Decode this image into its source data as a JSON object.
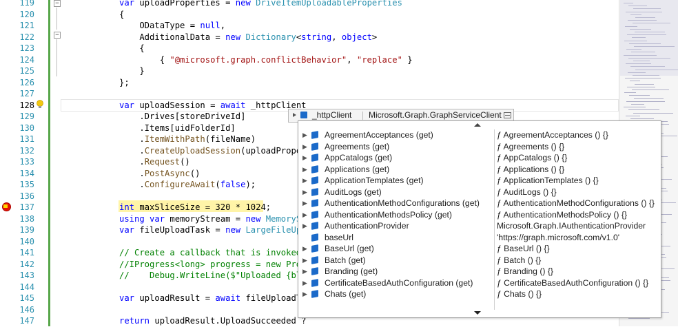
{
  "editor": {
    "line_numbers": [
      "119",
      "120",
      "121",
      "122",
      "123",
      "124",
      "125",
      "126",
      "127",
      "128",
      "129",
      "130",
      "131",
      "132",
      "133",
      "134",
      "135",
      "136",
      "137",
      "138",
      "139",
      "140",
      "141",
      "142",
      "143",
      "144",
      "145",
      "146",
      "147"
    ],
    "lines": [
      [
        [
          "kw",
          "var "
        ],
        [
          "lit",
          "uploadProperties = "
        ],
        [
          "kw",
          "new "
        ],
        [
          "ty",
          "DriveItemUploadableProperties"
        ]
      ],
      [
        [
          "lit",
          "{"
        ]
      ],
      [
        [
          "lit",
          "    ODataType = "
        ],
        [
          "kw",
          "null"
        ],
        [
          "lit",
          ","
        ]
      ],
      [
        [
          "lit",
          "    AdditionalData = "
        ],
        [
          "kw",
          "new "
        ],
        [
          "ty",
          "Dictionary"
        ],
        [
          "lit",
          "<"
        ],
        [
          "kw",
          "string"
        ],
        [
          "lit",
          ", "
        ],
        [
          "kw",
          "object"
        ],
        [
          "lit",
          ">"
        ]
      ],
      [
        [
          "lit",
          "    {"
        ]
      ],
      [
        [
          "lit",
          "        { "
        ],
        [
          "str",
          "\"@microsoft.graph.conflictBehavior\""
        ],
        [
          "lit",
          ", "
        ],
        [
          "str",
          "\"replace\""
        ],
        [
          "lit",
          " }"
        ]
      ],
      [
        [
          "lit",
          "    }"
        ]
      ],
      [
        [
          "lit",
          "};"
        ]
      ],
      [
        [
          "lit",
          ""
        ]
      ],
      [
        [
          "kw",
          "var "
        ],
        [
          "lit",
          "uploadSession = "
        ],
        [
          "kw",
          "await "
        ],
        [
          "lit",
          "_httpClient"
        ]
      ],
      [
        [
          "lit",
          "    .Drives[storeDriveId]"
        ]
      ],
      [
        [
          "lit",
          "    .Items[uidFolderId]"
        ]
      ],
      [
        [
          "lit",
          "    ."
        ],
        [
          "mt",
          "ItemWithPath"
        ],
        [
          "lit",
          "(fileName)"
        ]
      ],
      [
        [
          "lit",
          "    ."
        ],
        [
          "mt",
          "CreateUploadSession"
        ],
        [
          "lit",
          "(uploadProper"
        ]
      ],
      [
        [
          "lit",
          "    ."
        ],
        [
          "mt",
          "Request"
        ],
        [
          "lit",
          "()"
        ]
      ],
      [
        [
          "lit",
          "    ."
        ],
        [
          "mt",
          "PostAsync"
        ],
        [
          "lit",
          "()"
        ]
      ],
      [
        [
          "lit",
          "    ."
        ],
        [
          "mt",
          "ConfigureAwait"
        ],
        [
          "lit",
          "("
        ],
        [
          "kw",
          "false"
        ],
        [
          "lit",
          ");"
        ]
      ],
      [
        [
          "lit",
          ""
        ]
      ],
      [
        [
          "kw",
          "int "
        ],
        [
          "lit",
          "maxSliceSize = 320 * 1024;"
        ]
      ],
      [
        [
          "kw",
          "using var "
        ],
        [
          "lit",
          "memoryStream = "
        ],
        [
          "kw",
          "new "
        ],
        [
          "ty",
          "MemorySt"
        ]
      ],
      [
        [
          "kw",
          "var "
        ],
        [
          "lit",
          "fileUploadTask = "
        ],
        [
          "kw",
          "new "
        ],
        [
          "ty",
          "LargeFileUpl"
        ]
      ],
      [
        [
          "lit",
          ""
        ]
      ],
      [
        [
          "cm",
          "// Create a callback that is invoked"
        ]
      ],
      [
        [
          "cm",
          "//IProgress<long> progress = new Prog"
        ]
      ],
      [
        [
          "cm",
          "//    Debug.WriteLine($\"Uploaded {bla"
        ]
      ],
      [
        [
          "lit",
          ""
        ]
      ],
      [
        [
          "kw",
          "var "
        ],
        [
          "lit",
          "uploadResult = "
        ],
        [
          "kw",
          "await "
        ],
        [
          "lit",
          "fileUploadTa"
        ]
      ],
      [
        [
          "lit",
          ""
        ]
      ],
      [
        [
          "kw",
          "return "
        ],
        [
          "lit",
          "uploadResult.UploadSucceeded ?"
        ]
      ]
    ]
  },
  "quickinfo": {
    "identifier": "_httpClient",
    "type": "Microsoft.Graph.GraphServiceClient"
  },
  "completion": {
    "items": [
      {
        "name": "AgreementAcceptances (get)",
        "value": "ƒ AgreementAcceptances () {}",
        "expandable": true
      },
      {
        "name": "Agreements (get)",
        "value": "ƒ Agreements () {}",
        "expandable": true
      },
      {
        "name": "AppCatalogs (get)",
        "value": "ƒ AppCatalogs () {}",
        "expandable": true
      },
      {
        "name": "Applications (get)",
        "value": "ƒ Applications () {}",
        "expandable": true
      },
      {
        "name": "ApplicationTemplates (get)",
        "value": "ƒ ApplicationTemplates () {}",
        "expandable": true
      },
      {
        "name": "AuditLogs (get)",
        "value": "ƒ AuditLogs () {}",
        "expandable": true
      },
      {
        "name": "AuthenticationMethodConfigurations (get)",
        "value": "ƒ AuthenticationMethodConfigurations () {}",
        "expandable": true
      },
      {
        "name": "AuthenticationMethodsPolicy (get)",
        "value": "ƒ AuthenticationMethodsPolicy () {}",
        "expandable": true
      },
      {
        "name": "AuthenticationProvider",
        "value": "Microsoft.Graph.IAuthenticationProvider",
        "expandable": true
      },
      {
        "name": "baseUrl",
        "value": "'https://graph.microsoft.com/v1.0'",
        "expandable": false
      },
      {
        "name": "BaseUrl (get)",
        "value": "ƒ BaseUrl () {}",
        "expandable": true
      },
      {
        "name": "Batch (get)",
        "value": "ƒ Batch () {}",
        "expandable": true
      },
      {
        "name": "Branding (get)",
        "value": "ƒ Branding () {}",
        "expandable": true
      },
      {
        "name": "CertificateBasedAuthConfiguration (get)",
        "value": "ƒ CertificateBasedAuthConfiguration () {}",
        "expandable": true
      },
      {
        "name": "Chats (get)",
        "value": "ƒ Chats () {}",
        "expandable": true
      }
    ]
  },
  "colors": {
    "accent": "#1b6ac9",
    "breakpoint": "#e51400",
    "highlight": "#fff4a8"
  },
  "icons": {
    "bulb": "lightbulb-icon",
    "breakpoint": "breakpoint-icon",
    "member": "property-cube-icon"
  }
}
